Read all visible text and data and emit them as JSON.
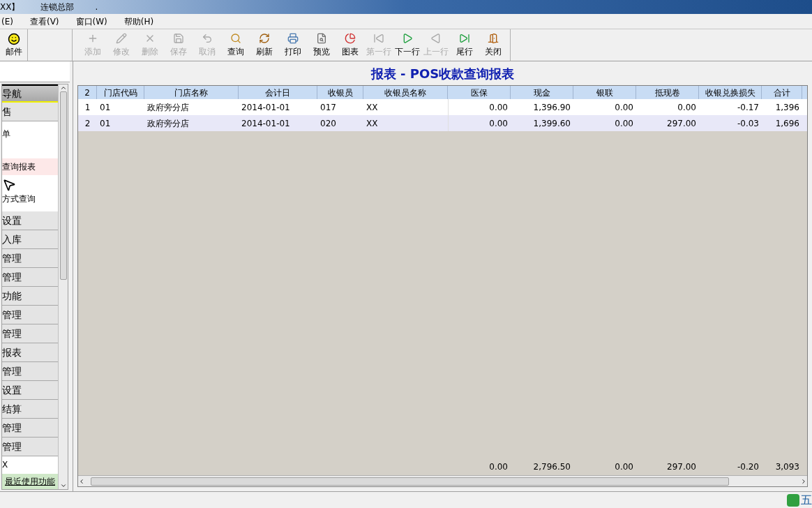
{
  "window": {
    "title_left": "XX】",
    "title": "连锁总部",
    "title_dot": "."
  },
  "menu": [
    "(E)",
    "查看(V)",
    "窗口(W)",
    "帮助(H)"
  ],
  "mail_button": {
    "label": "邮件"
  },
  "toolbar": [
    {
      "kind": "add",
      "label": "添加",
      "disabled": true
    },
    {
      "kind": "edit",
      "label": "修改",
      "disabled": true
    },
    {
      "kind": "delete",
      "label": "删除",
      "disabled": true
    },
    {
      "kind": "save",
      "label": "保存",
      "disabled": true
    },
    {
      "kind": "cancel",
      "label": "取消",
      "disabled": true
    },
    {
      "kind": "query",
      "label": "查询",
      "disabled": false
    },
    {
      "kind": "refresh",
      "label": "刷新",
      "disabled": false
    },
    {
      "kind": "print",
      "label": "打印",
      "disabled": false
    },
    {
      "kind": "preview",
      "label": "预览",
      "disabled": false
    },
    {
      "kind": "chart",
      "label": "图表",
      "disabled": false
    },
    {
      "kind": "first",
      "label": "第一行",
      "disabled": true
    },
    {
      "kind": "next",
      "label": "下一行",
      "disabled": false
    },
    {
      "kind": "prev",
      "label": "上一行",
      "disabled": true
    },
    {
      "kind": "last",
      "label": "尾行",
      "disabled": false
    },
    {
      "kind": "close",
      "label": "关闭",
      "disabled": false
    }
  ],
  "sidebar": {
    "header": "导航",
    "items": [
      {
        "kind": "section",
        "label": "售",
        "selected": false
      },
      {
        "kind": "item",
        "label": "单",
        "selected": false
      },
      {
        "kind": "item",
        "label": "查询报表",
        "selected": true
      },
      {
        "kind": "item",
        "label": "方式查询",
        "selected": false
      },
      {
        "kind": "section",
        "label": "设置",
        "selected": false
      },
      {
        "kind": "section",
        "label": "入库",
        "selected": false
      },
      {
        "kind": "section",
        "label": "管理",
        "selected": false
      },
      {
        "kind": "section",
        "label": "管理",
        "selected": false
      },
      {
        "kind": "section",
        "label": "功能",
        "selected": false
      },
      {
        "kind": "section",
        "label": "管理",
        "selected": false
      },
      {
        "kind": "section",
        "label": "管理",
        "selected": false
      },
      {
        "kind": "section",
        "label": "报表",
        "selected": false
      },
      {
        "kind": "section",
        "label": "管理",
        "selected": false
      },
      {
        "kind": "section",
        "label": "设置",
        "selected": false
      },
      {
        "kind": "section",
        "label": "结算",
        "selected": false
      },
      {
        "kind": "section",
        "label": "管理",
        "selected": false
      },
      {
        "kind": "section",
        "label": "管理",
        "selected": false
      },
      {
        "kind": "item",
        "label": "X",
        "selected": false
      }
    ],
    "footer": "最近使用功能"
  },
  "report": {
    "title": "报表 - POS收款查询报表",
    "table": {
      "columns": [
        "2",
        "门店代码",
        "门店名称",
        "会计日",
        "收银员",
        "收银员名称",
        "医保",
        "现金",
        "银联",
        "抵现卷",
        "收银兑换损失",
        "合计"
      ],
      "rows": [
        [
          "1",
          "01",
          "政府旁分店",
          "2014-01-01",
          "017",
          "XX",
          "0.00",
          "1,396.90",
          "0.00",
          "0.00",
          "-0.17",
          "1,396"
        ],
        [
          "2",
          "01",
          "政府旁分店",
          "2014-01-01",
          "020",
          "XX",
          "0.00",
          "1,399.60",
          "0.00",
          "297.00",
          "-0.03",
          "1,696"
        ]
      ],
      "totals": [
        "0.00",
        "2,796.50",
        "0.00",
        "297.00",
        "-0.20",
        "3,093"
      ]
    }
  },
  "status_bar": {
    "ime": "五"
  }
}
